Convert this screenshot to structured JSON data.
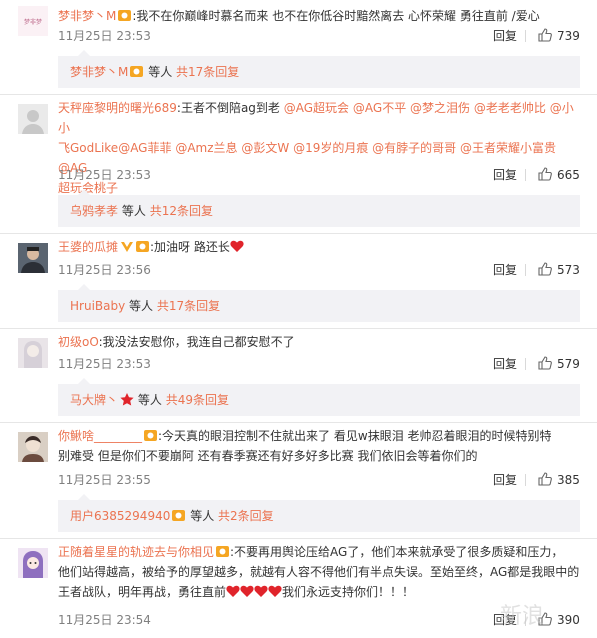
{
  "comments": [
    {
      "user": "梦非梦丶M",
      "segments": [
        ":我不在你巅峰时慕名而来 也不在你低谷时黯然离去 心怀荣耀 勇往直前 /爱心"
      ],
      "time": "11月25日 23:53",
      "reply_label": "回复",
      "likes": "739",
      "sub": {
        "user": "梦非梦丶M",
        "text": "等人",
        "more": "共17条回复"
      }
    },
    {
      "user": "天秤座黎明的曙光689",
      "line1_prefix": ":王者不倒陪ag到老",
      "mentions_line1": [
        "@AG超玩会",
        "@AG不平",
        "@梦之泪伤",
        "@老老老帅比",
        "@小小"
      ],
      "mentions_line2": [
        "飞GodLike",
        "@AG菲菲",
        "@Amz兰息",
        "@彭文W",
        "@19岁的月痕",
        "@有脖子的哥哥",
        "@王者荣耀小富贵",
        "@AG"
      ],
      "mentions_line3": [
        "超玩会桃子"
      ],
      "time": "11月25日 23:53",
      "reply_label": "回复",
      "likes": "665",
      "sub": {
        "user": "乌鸦孝孝",
        "text": "等人",
        "more": "共12条回复"
      }
    },
    {
      "user": "王婆的瓜摊",
      "text": ":加油呀 路还长",
      "time": "11月25日 23:56",
      "reply_label": "回复",
      "likes": "573",
      "sub": {
        "user": "HruiBaby",
        "text": "等人",
        "more": "共17条回复"
      }
    },
    {
      "user": "初级oO",
      "text": ":我没法安慰你，我连自己都安慰不了",
      "time": "11月25日 23:53",
      "reply_label": "回复",
      "likes": "579",
      "sub": {
        "user": "马大牌丶",
        "text": "等人",
        "more": "共49条回复"
      }
    },
    {
      "user": "你鰍啥________",
      "line1": ":今天真的眼泪控制不住就出来了 看见w抹眼泪 老帅忍着眼泪的时候特别特",
      "line2": "别难受 但是你们不要崩阿 还有春季赛还有好多好多比赛 我们依旧会等着你们的",
      "time": "11月25日 23:55",
      "reply_label": "回复",
      "likes": "385",
      "sub": {
        "user": "用户6385294940",
        "text": "等人",
        "more": "共2条回复"
      }
    },
    {
      "user": "正随着星星的轨迹去与你相见",
      "line1": ":不要再用舆论压给AG了，他们本来就承受了很多质疑和压力，",
      "line2": "他们站得越高，被给予的厚望越多，就越有人容不得他们有半点失误。至始至终，AG都是我眼中的",
      "line3a": "王者战队，明年再战，勇往直前",
      "line3b": "我们永远支持你们！！！",
      "time": "11月25日 23:54",
      "reply_label": "回复",
      "likes": "390"
    }
  ],
  "watermark": "新浪",
  "colors": {
    "link": "#eb7350",
    "meta": "#808080",
    "subbox": "#f2f2f5",
    "heart": "#e0242b",
    "vip": "#f5a623"
  }
}
